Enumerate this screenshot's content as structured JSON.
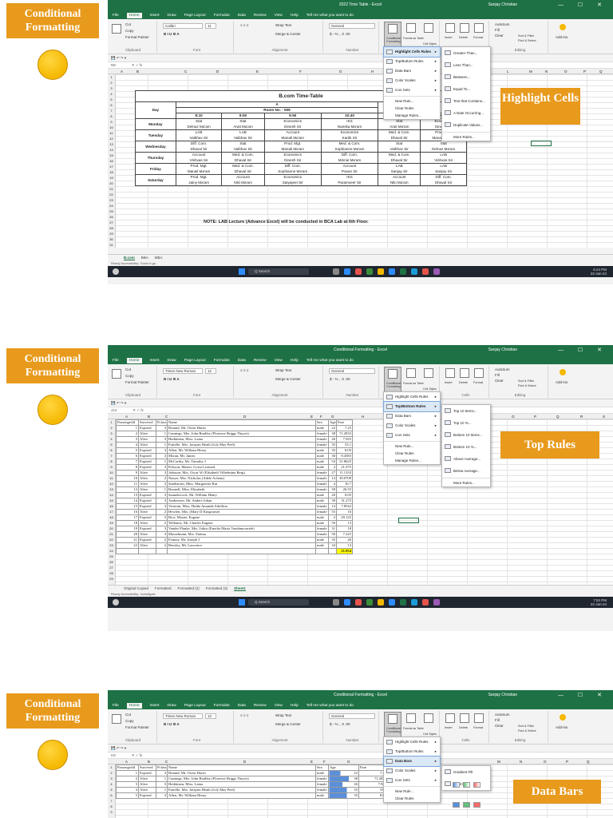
{
  "label_text": "Conditional Formatting",
  "colors": {
    "excel_green": "#1e7145",
    "orange": "#e89a1c",
    "yellow": "#f5b800",
    "total_fill": "#ffff00",
    "databar_blue": "#5b8fd8"
  },
  "ribbon": {
    "tabs": [
      "File",
      "Home",
      "Insert",
      "Draw",
      "Page Layout",
      "Formulas",
      "Data",
      "Review",
      "View",
      "Help",
      "Tell me what you want to do"
    ],
    "clipboard": {
      "cut": "Cut",
      "copy": "Copy",
      "format_painter": "Format Painter",
      "group": "Clipboard"
    },
    "font_group": "Font",
    "alignment": {
      "wrap": "Wrap Text",
      "merge": "Merge & Center",
      "group": "Alignment"
    },
    "number": {
      "format": "General",
      "group": "Number"
    },
    "styles": {
      "cf": "Conditional Formatting",
      "table": "Format as Table",
      "cell": "Cell Styles"
    },
    "cells": {
      "insert": "Insert",
      "delete": "Delete",
      "format": "Format",
      "group": "Cells"
    },
    "editing": {
      "autosum": "AutoSum",
      "fill": "Fill",
      "clear": "Clear",
      "sort": "Sort & Filter",
      "find": "Find & Select",
      "group": "Editing"
    },
    "addins": "Add-ins"
  },
  "panels": [
    {
      "window_title": "2022 Time Table - Excel",
      "user": "Sanjay Christian",
      "font": "Calibri",
      "size": "11",
      "namebox": "N9",
      "sheet_tabs": [
        "B.com",
        "BBA",
        "MBA"
      ],
      "active_tab": "B.com",
      "status": "Ready   Accessibility: Good to go",
      "time": "6:24 PM",
      "date": "22-Jan-24",
      "callout": "Highlight Cells",
      "menu_main": [
        "Highlight Cells Rules",
        "Top/Bottom Rules",
        "Data Bars",
        "Color Scales",
        "Icon Sets",
        "New Rule...",
        "Clear Rules",
        "Manage Rules..."
      ],
      "menu_sub": [
        "Greater Than...",
        "Less Than...",
        "Between...",
        "Equal To...",
        "Text that Contains...",
        "A Date Occurring...",
        "Duplicate Values...",
        "More Rules..."
      ],
      "timetable": {
        "title": "B.com Time-Table",
        "division": "A",
        "room": "Room No. - 509",
        "room_b_partial": "Ro",
        "day_header": "Day",
        "times": [
          "8:10",
          "9:00",
          "9:50",
          "10:40",
          "8:10",
          "9:00"
        ],
        "rows": [
          {
            "day": "Monday",
            "r1": [
              "Stat",
              "Stat",
              "Economics",
              "IKS",
              "Stat",
              "Economics"
            ],
            "r2": [
              "Delnaz Ma'am",
              "Arati Ma'am",
              "Dinesh Sir",
              "Namika Ma'am",
              "Arati Ma'am",
              "Dinesh Sir"
            ]
          },
          {
            "day": "Tuesday",
            "r1": [
              "LAB",
              "LAB",
              "Account",
              "Economics",
              "Med. & Com.",
              "Prod. Mgt."
            ],
            "r2": [
              "Vaibhav Sir",
              "Vaibhav Sir",
              "Manali Ma'am",
              "Kartik Sir",
              "Dhaval Sir",
              "Manali Ma'am"
            ]
          },
          {
            "day": "Wednesday",
            "r1": [
              "Diff. Com.",
              "Stat",
              "Prod. Mgt.",
              "Med. & Com.",
              "Stat",
              "Stat"
            ],
            "r2": [
              "Dhaval Sir",
              "Vaibhav Sir",
              "Manali Ma'am",
              "Sophianne Ma'am",
              "Vaibhav Sir",
              "Delnaz Ma'am"
            ]
          },
          {
            "day": "Thursday",
            "r1": [
              "Account",
              "Med. & Com.",
              "Economics",
              "Diff. Com.",
              "Med. & Com.",
              "LAB"
            ],
            "r2": [
              "Vishvas Sir",
              "Dhaval Sir",
              "Dinesh Sir",
              "Minnie Ma'am",
              "Dhaval Sir",
              "Vishvas Sir"
            ]
          },
          {
            "day": "Friday",
            "r1": [
              "Prod. Mgt.",
              "Med. & Com.",
              "Diff. Com.",
              "Account",
              "LAB",
              "LAB"
            ],
            "r2": [
              "Manali Ma'am",
              "Dhaval Sir",
              "Sophianne Ma'am",
              "Pavan Sir",
              "Sanjay Sir",
              "Sanjay Sir"
            ]
          },
          {
            "day": "Saturday",
            "r1": [
              "Prod. Mgt.",
              "Account",
              "Economics",
              "IKS",
              "Account",
              "Diff. Com."
            ],
            "r2": [
              "Jainy Ma'am",
              "Niki Ma'am",
              "Satyajeet Sir",
              "Paramveer Sir",
              "Niki Ma'am",
              "Dhaval Sir"
            ]
          }
        ],
        "note": "NOTE: LAB Lecture (Advance Excel) will be conducted in BCA Lab at 6th Floor."
      }
    },
    {
      "window_title": "Conditional Formatting - Excel",
      "user": "Sanjay Christian",
      "font": "Times New Roman",
      "size": "12",
      "namebox": "J14",
      "sheet_tabs": [
        "Original Copied",
        "Formatted",
        "Formatted (2)",
        "Formatted (3)",
        "Sheet1"
      ],
      "active_tab": "Sheet1",
      "status": "Ready   Accessibility: Investigate",
      "time": "7:52 PM",
      "date": "22-Jan-24",
      "callout": "Top Rules",
      "menu_main": [
        "Highlight Cells Rules",
        "Top/Bottom Rules",
        "Data Bars",
        "Color Scales",
        "Icon Sets",
        "New Rule...",
        "Clear Rules",
        "Manage Rules..."
      ],
      "menu_sub": [
        "Top 10 Items...",
        "Top 10 %...",
        "Bottom 10 Items...",
        "Bottom 10 %...",
        "Above Average...",
        "Below Average...",
        "More Rules..."
      ],
      "total": "21.954"
    },
    {
      "window_title": "Conditional Formatting - Excel",
      "user": "Sanjay Christian",
      "font": "Times New Roman",
      "size": "12",
      "namebox": "H3",
      "callout": "Data Bars",
      "menu_main": [
        "Highlight Cells Rules",
        "Top/Bottom Rules",
        "Data Bars",
        "Color Scales",
        "Icon Sets",
        "New Rule...",
        "Clear Rules"
      ],
      "menu_sub": [
        "Gradient Fill",
        "Solid Fill"
      ]
    }
  ],
  "passengers": {
    "headers": [
      "PassengerId",
      "Survived",
      "Pclass",
      "Name",
      "Sex",
      "Age",
      "Fare"
    ],
    "rows": [
      [
        "1",
        "Expired",
        "3",
        "Braund, Mr. Owen Harris",
        "male",
        "22",
        "7.25"
      ],
      [
        "2",
        "Alive",
        "1",
        "Cumings, Mrs. John Bradley (Florence Briggs Thayer)",
        "female",
        "38",
        "71.2833"
      ],
      [
        "3",
        "Alive",
        "3",
        "Heikkinen, Miss. Laina",
        "female",
        "26",
        "7.925"
      ],
      [
        "4",
        "Alive",
        "1",
        "Futrelle, Mrs. Jacques Heath (Lily May Peel)",
        "female",
        "35",
        "53.1"
      ],
      [
        "5",
        "Expired",
        "3",
        "Allen, Mr. William Henry",
        "male",
        "35",
        "8.05"
      ],
      [
        "6",
        "Expired",
        "3",
        "Moran, Mr. James",
        "male",
        "30",
        "8.4583"
      ],
      [
        "7",
        "Expired",
        "1",
        "McCarthy, Mr. Timothy J",
        "male",
        "54",
        "51.8625"
      ],
      [
        "8",
        "Expired",
        "3",
        "Palsson, Master. Gosta Leonard",
        "male",
        "2",
        "21.075"
      ],
      [
        "9",
        "Alive",
        "3",
        "Johnson, Mrs. Oscar W (Elisabeth Vilhelmina Berg)",
        "female",
        "27",
        "11.1333"
      ],
      [
        "10",
        "Alive",
        "2",
        "Nasser, Mrs. Nicholas (Adele Achem)",
        "female",
        "14",
        "30.0708"
      ],
      [
        "11",
        "Alive",
        "3",
        "Sandstrom, Miss. Marguerite Rut",
        "female",
        "4",
        "16.7"
      ],
      [
        "12",
        "Alive",
        "1",
        "Bonnell, Miss. Elizabeth",
        "female",
        "58",
        "26.55"
      ],
      [
        "13",
        "Expired",
        "3",
        "Saundercock, Mr. William Henry",
        "male",
        "20",
        "8.05"
      ],
      [
        "14",
        "Expired",
        "3",
        "Andersson, Mr. Anders Johan",
        "male",
        "39",
        "31.275"
      ],
      [
        "15",
        "Expired",
        "3",
        "Vestrom, Miss. Hulda Amanda Adolfina",
        "female",
        "14",
        "7.8542"
      ],
      [
        "16",
        "Alive",
        "2",
        "Hewlett, Mrs. (Mary D Kingcome)",
        "female",
        "55",
        "16"
      ],
      [
        "17",
        "Expired",
        "3",
        "Rice, Master. Eugene",
        "male",
        "2",
        "29.125"
      ],
      [
        "18",
        "Alive",
        "2",
        "Williams, Mr. Charles Eugene",
        "male",
        "50",
        "13"
      ],
      [
        "19",
        "Expired",
        "3",
        "Vander Planke, Mrs. Julius (Emelia Maria Vandemoortele)",
        "female",
        "31",
        "18"
      ],
      [
        "20",
        "Alive",
        "3",
        "Masselmani, Mrs. Fatima",
        "female",
        "50",
        "7.225"
      ],
      [
        "21",
        "Expired",
        "2",
        "Fynney, Mr. Joseph J",
        "male",
        "35",
        "26"
      ],
      [
        "22",
        "Alive",
        "2",
        "Beesley, Mr. Lawrence",
        "male",
        "34",
        "13"
      ]
    ]
  }
}
